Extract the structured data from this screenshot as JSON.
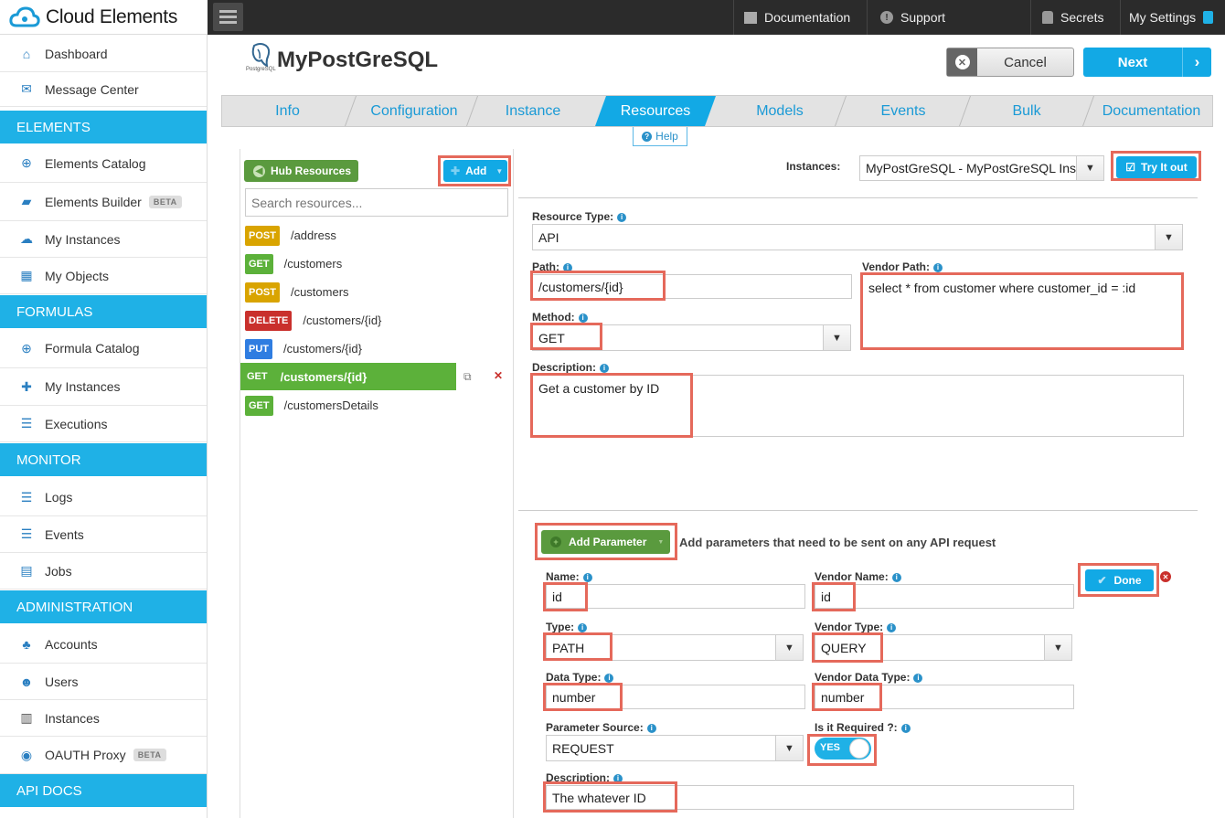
{
  "app": {
    "name": "Cloud Elements"
  },
  "topnav": {
    "documentation": "Documentation",
    "support": "Support",
    "secrets": "Secrets",
    "settings": "My Settings"
  },
  "sidebar": {
    "dashboard": "Dashboard",
    "message_center": "Message Center",
    "elements_head": "ELEMENTS",
    "elements_catalog": "Elements Catalog",
    "elements_builder": "Elements Builder",
    "elements_builder_badge": "BETA",
    "my_instances": "My Instances",
    "my_objects": "My Objects",
    "formulas_head": "FORMULAS",
    "formula_catalog": "Formula Catalog",
    "formula_instances": "My Instances",
    "executions": "Executions",
    "monitor_head": "MONITOR",
    "logs": "Logs",
    "events": "Events",
    "jobs": "Jobs",
    "admin_head": "ADMINISTRATION",
    "accounts": "Accounts",
    "users": "Users",
    "instances": "Instances",
    "oauth_proxy": "OAUTH Proxy",
    "oauth_badge": "BETA",
    "api_docs_head": "API DOCS"
  },
  "header": {
    "logo_caption": "PostgreSQL",
    "title": "MyPostGreSQL",
    "cancel": "Cancel",
    "next": "Next"
  },
  "tabs": [
    "Info",
    "Configuration",
    "Instance",
    "Resources",
    "Models",
    "Events",
    "Bulk",
    "Documentation"
  ],
  "help": "Help",
  "resources": {
    "hub_button": "Hub Resources",
    "add_button": "Add",
    "search_placeholder": "Search resources...",
    "items": [
      {
        "method": "POST",
        "path": "/address"
      },
      {
        "method": "GET",
        "path": "/customers"
      },
      {
        "method": "POST",
        "path": "/customers"
      },
      {
        "method": "DELETE",
        "path": "/customers/{id}"
      },
      {
        "method": "PUT",
        "path": "/customers/{id}"
      },
      {
        "method": "GET",
        "path": "/customers/{id}"
      },
      {
        "method": "GET",
        "path": "/customersDetails"
      }
    ]
  },
  "instances": {
    "label": "Instances:",
    "value": "MyPostGreSQL - MyPostGreSQL Ins",
    "try_button": "Try It out"
  },
  "form": {
    "resource_type_label": "Resource Type:",
    "resource_type": "API",
    "path_label": "Path:",
    "path": "/customers/{id}",
    "vendor_path_label": "Vendor Path:",
    "vendor_path": "select * from customer where customer_id = :id",
    "method_label": "Method:",
    "method": "GET",
    "description_label": "Description:",
    "description": "Get a customer by ID"
  },
  "params": {
    "add_button": "Add Parameter",
    "hint": "Add parameters that need to be sent on any API request",
    "done_button": "Done",
    "name_label": "Name:",
    "name": "id",
    "vendor_name_label": "Vendor Name:",
    "vendor_name": "id",
    "type_label": "Type:",
    "type": "PATH",
    "vendor_type_label": "Vendor Type:",
    "vendor_type": "QUERY",
    "data_type_label": "Data Type:",
    "data_type": "number",
    "vendor_data_type_label": "Vendor Data Type:",
    "vendor_data_type": "number",
    "source_label": "Parameter Source:",
    "source": "REQUEST",
    "required_label": "Is it Required ?:",
    "required": "YES",
    "description_label": "Description:",
    "description": "The whatever ID"
  },
  "colors": {
    "accent": "#12a9e5",
    "highlight": "#e5695b",
    "green": "#5a9a3e"
  }
}
